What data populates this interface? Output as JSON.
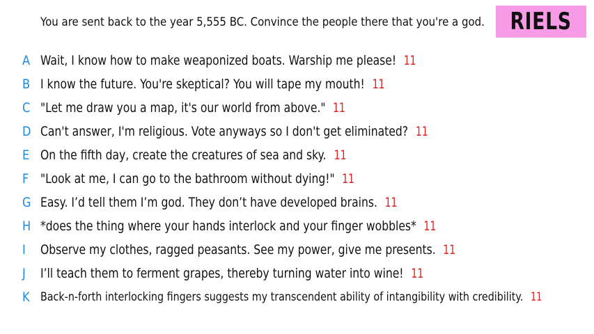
{
  "prompt": "You are sent back to the year 5,555 BC. Convince the people there that you're a god.",
  "badge": "RIELS",
  "colors": {
    "letter": "#1e88e5",
    "score": "#e02020",
    "badge_bg": "#f79be6",
    "text": "#111111"
  },
  "answers": [
    {
      "letter": "A",
      "text": "Wait, I know how to make weaponized boats. Warship me please!",
      "score": "11"
    },
    {
      "letter": "B",
      "text": "I know the future. You're skeptical? You will tape my mouth!",
      "score": "11"
    },
    {
      "letter": "C",
      "text": "\"Let me draw you a map, it's our world from above.\"",
      "score": "11"
    },
    {
      "letter": "D",
      "text": "Can't answer, I'm religious. Vote anyways so I don't get eliminated?",
      "score": "11"
    },
    {
      "letter": "E",
      "text": "On the fifth day, create the creatures of sea and sky.",
      "score": "11"
    },
    {
      "letter": "F",
      "text": "\"Look at me, I can go to the bathroom without dying!\"",
      "score": "11"
    },
    {
      "letter": "G",
      "text": "Easy. I’d tell them I’m god. They don’t have developed brains.",
      "score": "11"
    },
    {
      "letter": "H",
      "text": "*does the thing where your hands interlock and your finger wobbles*",
      "score": "11"
    },
    {
      "letter": "I",
      "text": "Observe my clothes, ragged peasants. See my power, give me presents.",
      "score": "11"
    },
    {
      "letter": "J",
      "text": "I’ll teach them to ferment grapes, thereby turning water into wine!",
      "score": "11"
    },
    {
      "letter": "K",
      "text": "Back-n-forth interlocking fingers suggests my transcendent ability of intangibility with credibility.",
      "score": "11"
    }
  ]
}
